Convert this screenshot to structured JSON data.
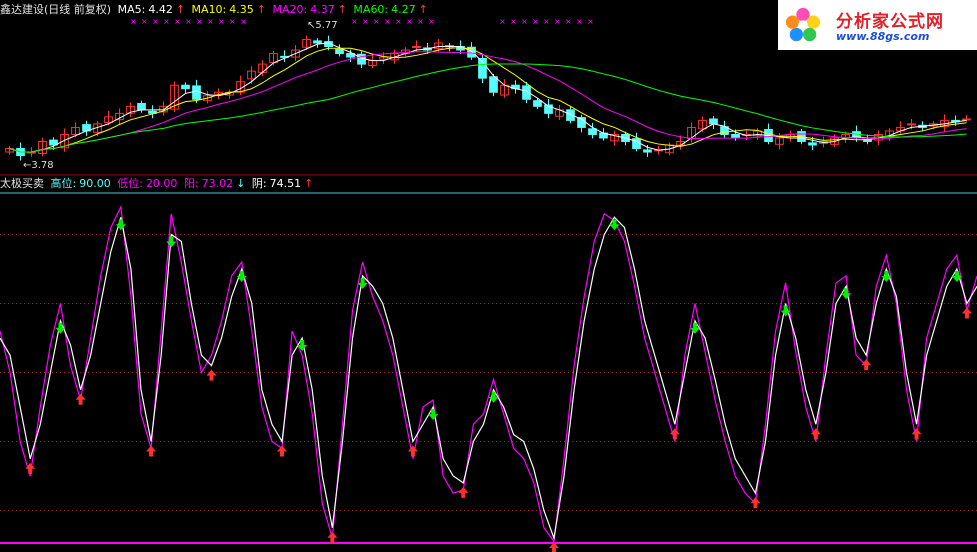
{
  "top_header": {
    "stock": "鑫达建设(日线 前复权)",
    "ma5_label": "MA5:",
    "ma5_value": "4.42",
    "ma10_label": "MA10:",
    "ma10_value": "4.35",
    "ma20_label": "MA20:",
    "ma20_value": "4.37",
    "ma60_label": "MA60:",
    "ma60_value": "4.27",
    "up_arrow": "↑",
    "down_arrow": "↓"
  },
  "bottom_header": {
    "indicator": "太极买卖",
    "high_label": "高位:",
    "high_value": "90.00",
    "low_label": "低位:",
    "low_value": "20.00",
    "yang_label": "阳:",
    "yang_value": "73.02",
    "yin_label": "阴:",
    "yin_value": "74.51"
  },
  "logo": {
    "title": "分析家公式网",
    "url": "www.88gs.com"
  },
  "colors": {
    "bg": "#000000",
    "up_candle": "#ff3232",
    "down_candle": "#54ffff",
    "ma5": "#ffffff",
    "ma10": "#ffff00",
    "ma20": "#ff00ff",
    "ma60": "#00ff00",
    "yang_line": "#ffffff",
    "yin_line": "#ff00ff",
    "divider": "#aa0000",
    "buy_arrow": "#ff3030",
    "sell_arrow": "#00ee00",
    "marker": "#ff00ff"
  },
  "chart_data": [
    {
      "type": "candlestick",
      "annotations": [
        {
          "text": "5.77"
        },
        {
          "text": "3.78"
        }
      ],
      "price_range": [
        3.78,
        5.77
      ],
      "series": [
        {
          "name": "MA5",
          "value": 4.42
        },
        {
          "name": "MA10",
          "value": 4.35
        },
        {
          "name": "MA20",
          "value": 4.37
        },
        {
          "name": "MA60",
          "value": 4.27
        }
      ],
      "close": [
        4.0,
        3.9,
        3.95,
        4.1,
        4.05,
        4.2,
        4.3,
        4.25,
        4.35,
        4.45,
        4.5,
        4.6,
        4.55,
        4.5,
        4.6,
        4.9,
        4.85,
        4.7,
        4.75,
        4.8,
        4.8,
        4.95,
        5.1,
        5.2,
        5.35,
        5.3,
        5.4,
        5.55,
        5.5,
        5.45,
        5.35,
        5.3,
        5.2,
        5.25,
        5.3,
        5.35,
        5.4,
        5.45,
        5.4,
        5.5,
        5.45,
        5.4,
        5.3,
        5.0,
        4.8,
        4.9,
        4.85,
        4.7,
        4.6,
        4.5,
        4.55,
        4.4,
        4.3,
        4.2,
        4.15,
        4.2,
        4.1,
        4.0,
        3.95,
        3.98,
        4.05,
        4.1,
        4.3,
        4.4,
        4.35,
        4.2,
        4.15,
        4.2,
        4.25,
        4.1,
        4.15,
        4.2,
        4.1,
        4.05,
        4.1,
        4.15,
        4.2,
        4.15,
        4.1,
        4.2,
        4.25,
        4.3,
        4.35,
        4.3,
        4.35,
        4.4,
        4.38,
        4.42
      ]
    },
    {
      "type": "line",
      "ylim": [
        0,
        100
      ],
      "levels": {
        "high": 90.0,
        "low": 20.0
      },
      "series": [
        {
          "name": "阳",
          "values": [
            60,
            55,
            40,
            25,
            35,
            50,
            65,
            58,
            45,
            55,
            70,
            85,
            95,
            80,
            45,
            30,
            55,
            90,
            88,
            70,
            55,
            52,
            60,
            72,
            80,
            70,
            45,
            35,
            30,
            55,
            60,
            45,
            20,
            5,
            30,
            60,
            78,
            75,
            70,
            60,
            45,
            30,
            35,
            40,
            25,
            20,
            18,
            30,
            35,
            45,
            40,
            32,
            30,
            22,
            10,
            2,
            20,
            45,
            65,
            80,
            90,
            95,
            92,
            80,
            65,
            55,
            45,
            35,
            50,
            65,
            60,
            48,
            35,
            25,
            20,
            15,
            30,
            55,
            70,
            60,
            45,
            35,
            50,
            70,
            75,
            60,
            55,
            70,
            80,
            72,
            50,
            35,
            55,
            65,
            75,
            80,
            70,
            75
          ]
        },
        {
          "name": "阴",
          "values": [
            62,
            50,
            30,
            20,
            40,
            58,
            70,
            52,
            42,
            60,
            78,
            92,
            98,
            72,
            38,
            28,
            62,
            96,
            82,
            65,
            50,
            55,
            65,
            78,
            82,
            62,
            40,
            30,
            28,
            62,
            55,
            38,
            12,
            2,
            35,
            68,
            82,
            72,
            65,
            55,
            40,
            25,
            40,
            42,
            20,
            15,
            16,
            35,
            38,
            48,
            38,
            28,
            25,
            18,
            5,
            1,
            25,
            52,
            72,
            88,
            96,
            94,
            88,
            75,
            60,
            50,
            40,
            30,
            55,
            70,
            56,
            42,
            30,
            20,
            15,
            12,
            35,
            62,
            76,
            56,
            40,
            30,
            55,
            76,
            78,
            55,
            52,
            75,
            84,
            70,
            45,
            30,
            60,
            70,
            80,
            84,
            68,
            78
          ]
        }
      ]
    }
  ]
}
